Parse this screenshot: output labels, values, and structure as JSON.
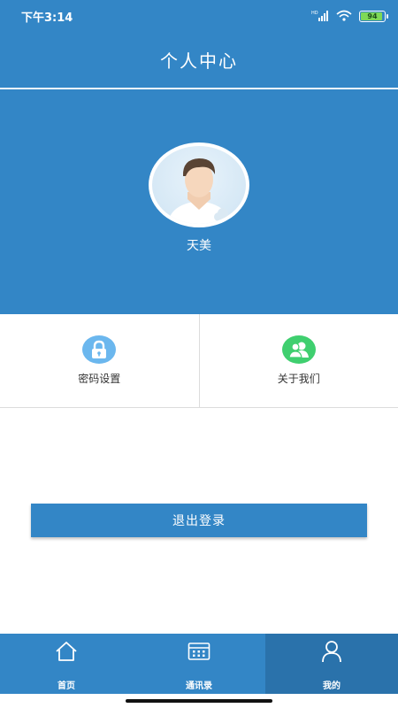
{
  "status_bar": {
    "time": "下午3:14",
    "battery": "94",
    "battery_level": 0.94,
    "network_label": "HD"
  },
  "header": {
    "title": "个人中心"
  },
  "profile": {
    "username": "天美"
  },
  "menu": [
    {
      "label": "密码设置",
      "icon": "lock-icon",
      "color": "#6bb7ee"
    },
    {
      "label": "关于我们",
      "icon": "users-icon",
      "color": "#3fcf6f"
    }
  ],
  "logout": {
    "label": "退出登录"
  },
  "tabbar": {
    "tabs": [
      {
        "label": "首页",
        "icon": "home-icon"
      },
      {
        "label": "通讯录",
        "icon": "contacts-icon"
      },
      {
        "label": "我的",
        "icon": "person-icon",
        "active": true
      }
    ]
  },
  "colors": {
    "primary": "#3386c6",
    "active_tab": "#2a72ab"
  }
}
